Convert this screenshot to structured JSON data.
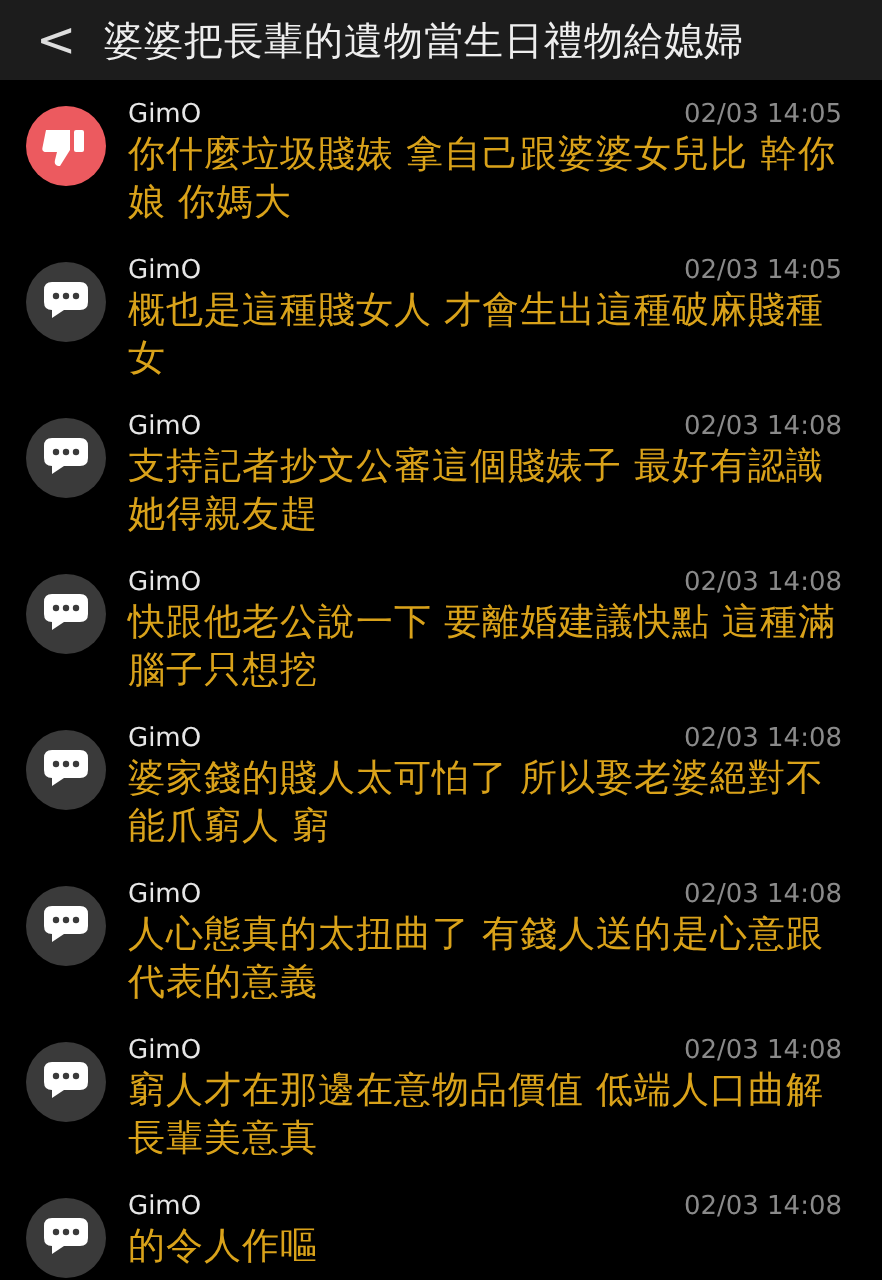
{
  "header": {
    "back": "<",
    "title": "婆婆把長輩的遺物當生日禮物給媳婦"
  },
  "comments": [
    {
      "kind": "dislike",
      "author": "GimO",
      "time": "02/03 14:05",
      "text": "你什麼垃圾賤婊 拿自己跟婆婆女兒比 幹你娘 你媽大"
    },
    {
      "kind": "comment",
      "author": "GimO",
      "time": "02/03 14:05",
      "text": "概也是這種賤女人 才會生出這種破麻賤種女"
    },
    {
      "kind": "comment",
      "author": "GimO",
      "time": "02/03 14:08",
      "text": "支持記者抄文公審這個賤婊子 最好有認識她得親友趕"
    },
    {
      "kind": "comment",
      "author": "GimO",
      "time": "02/03 14:08",
      "text": "快跟他老公說一下 要離婚建議快點 這種滿腦子只想挖"
    },
    {
      "kind": "comment",
      "author": "GimO",
      "time": "02/03 14:08",
      "text": "婆家錢的賤人太可怕了 所以娶老婆絕對不能爪窮人 窮"
    },
    {
      "kind": "comment",
      "author": "GimO",
      "time": "02/03 14:08",
      "text": "人心態真的太扭曲了 有錢人送的是心意跟代表的意義"
    },
    {
      "kind": "comment",
      "author": "GimO",
      "time": "02/03 14:08",
      "text": "窮人才在那邊在意物品價值 低端人口曲解長輩美意真"
    },
    {
      "kind": "comment",
      "author": "GimO",
      "time": "02/03 14:08",
      "text": "的令人作嘔"
    }
  ]
}
